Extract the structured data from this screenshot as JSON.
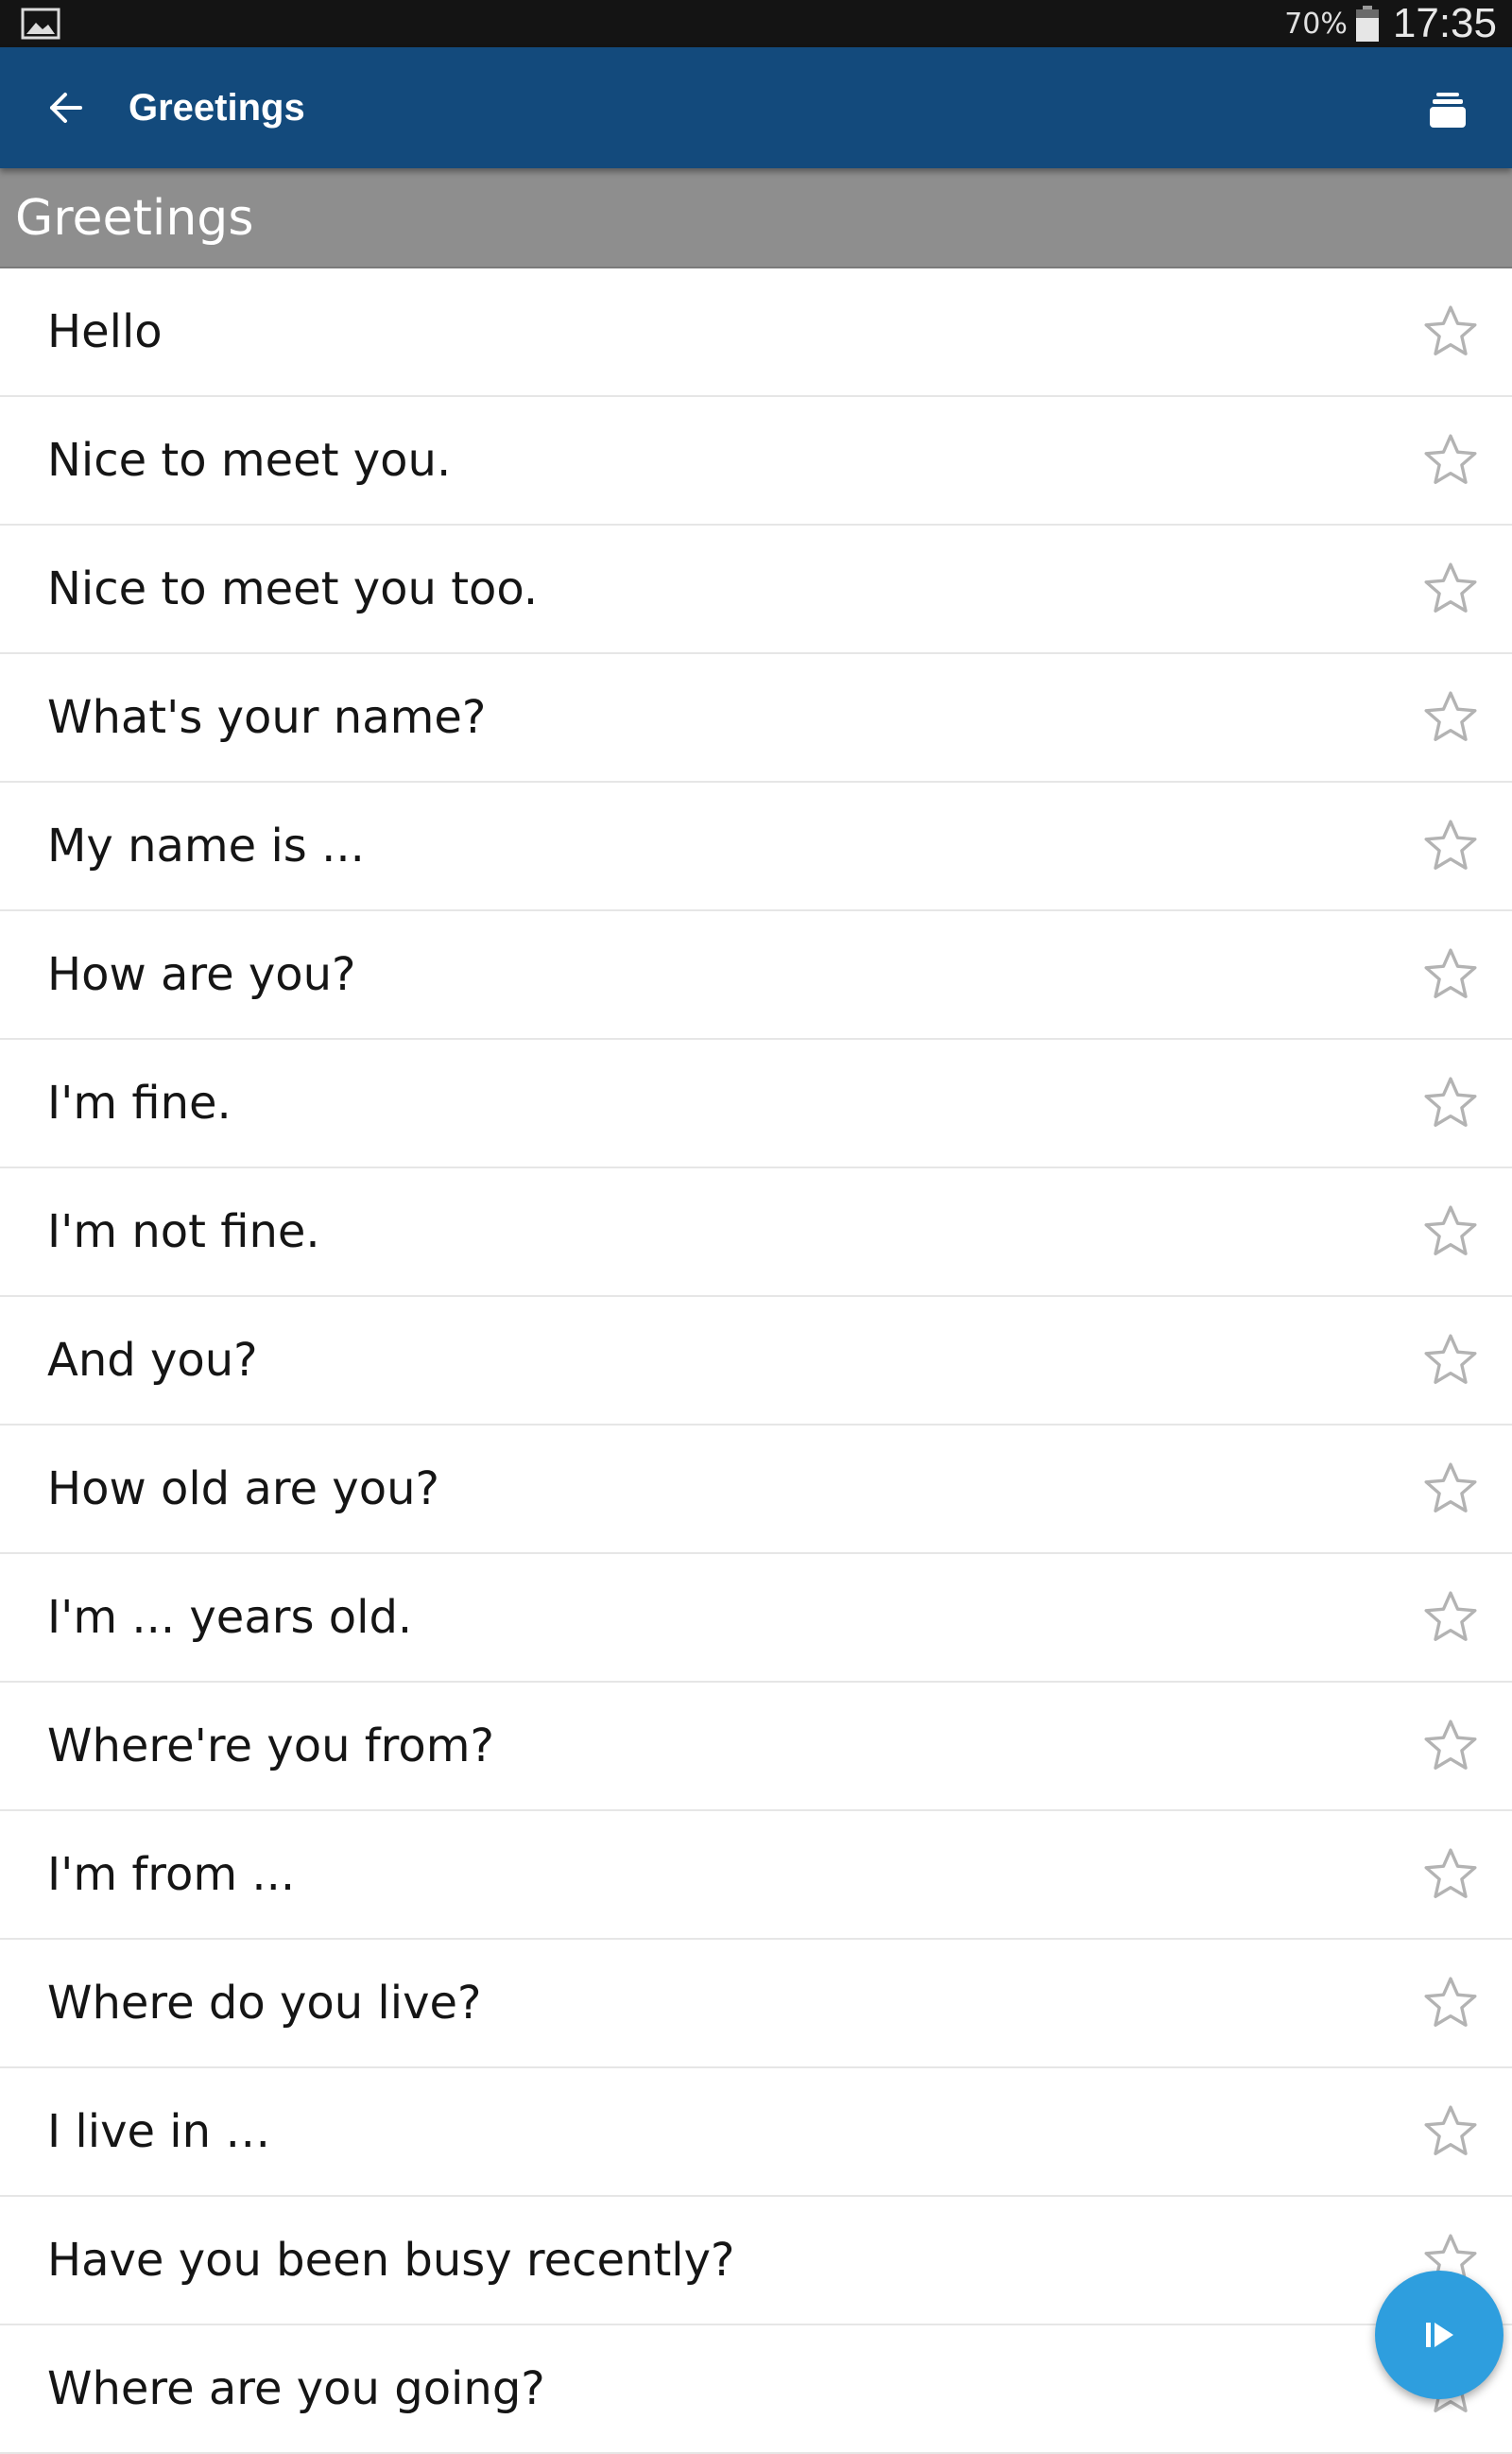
{
  "status_bar": {
    "battery_percent": "70%",
    "time": "17:35",
    "left_icon": "image-notification-icon",
    "battery_icon": "battery-icon"
  },
  "app_bar": {
    "title": "Greetings",
    "back_icon": "arrow-back-icon",
    "action_icon": "stack-icon",
    "background": "#134a7c"
  },
  "section": {
    "title": "Greetings",
    "background": "#8e8e8e"
  },
  "phrases": [
    {
      "text": "Hello"
    },
    {
      "text": "Nice to meet you."
    },
    {
      "text": "Nice to meet you too."
    },
    {
      "text": "What's your name?"
    },
    {
      "text": "My name is ..."
    },
    {
      "text": "How are you?"
    },
    {
      "text": "I'm fine."
    },
    {
      "text": "I'm not fine."
    },
    {
      "text": "And you?"
    },
    {
      "text": "How old are you?"
    },
    {
      "text": "I'm ... years old."
    },
    {
      "text": "Where're you from?"
    },
    {
      "text": "I'm from ..."
    },
    {
      "text": "Where do you live?"
    },
    {
      "text": "I live in …"
    },
    {
      "text": "Have you been busy recently?"
    },
    {
      "text": "Where are you going?"
    }
  ],
  "row_icon": "star-outline-icon",
  "fab": {
    "icon": "play-icon",
    "color": "#2e9ede"
  }
}
